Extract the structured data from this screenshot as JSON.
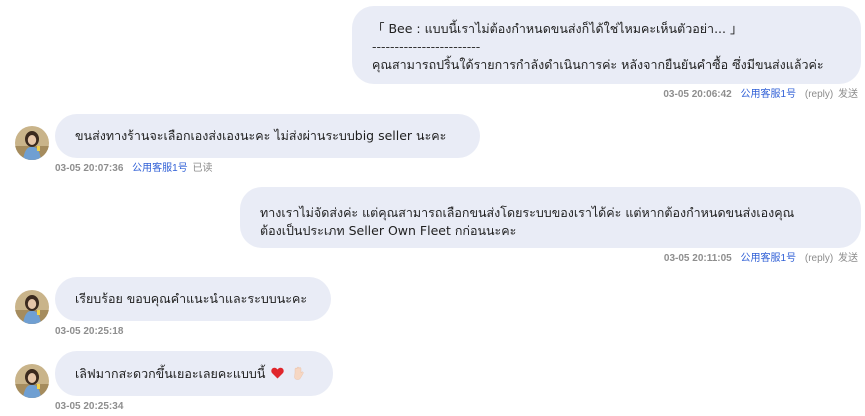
{
  "messages": [
    {
      "side": "right",
      "quote": "「 Bee : แบบนี้เราไม่ต้องกำหนดขนส่งก็ได้ใช่ไหมคะเห็นตัวอย่า... 」",
      "divider": "------------------------",
      "text": "คุณสามารถปริ้นใด้รายการกำลังดำเนินการค่ะ หลังจากยืนยันคำซื้อ ซึ่งมีขนส่งแล้วค่ะ",
      "time": "03-05 20:06:42",
      "agent": "公用客服1号",
      "reply": "(reply)",
      "status": "发送"
    },
    {
      "side": "left",
      "text": "ขนส่งทางร้านจะเลือกเองส่งเองนะคะ ไม่ส่งผ่านระบบbig seller นะคะ",
      "time": "03-05 20:07:36",
      "agent": "公用客服1号",
      "status": "已读"
    },
    {
      "side": "right",
      "line1": "ทางเราไม่จัดส่งค่ะ แต่คุณสามารถเลือกขนส่งโดยระบบของเราได้ค่ะ แต่หากต้องกำหนดขนส่งเองคุณ",
      "line2": "ต้องเป็นประเภท Seller Own Fleet กก่อนนะคะ",
      "time": "03-05 20:11:05",
      "agent": "公用客服1号",
      "reply": "(reply)",
      "status": "发送"
    },
    {
      "side": "left",
      "text": "เรียบร้อย ขอบคุณคำแนะนำและระบบนะคะ",
      "time": "03-05 20:25:18"
    },
    {
      "side": "left",
      "text": "เลิฟมากสะดวกขึ้นเยอะเลยคะแบบนี้",
      "emoji": [
        "red-heart",
        "raised-hand"
      ],
      "time": "03-05 20:25:34"
    }
  ],
  "colors": {
    "bubble_bg": "#e9ecf6",
    "agent_link": "#2f5fd6",
    "meta_gray": "#8c8c8c"
  }
}
